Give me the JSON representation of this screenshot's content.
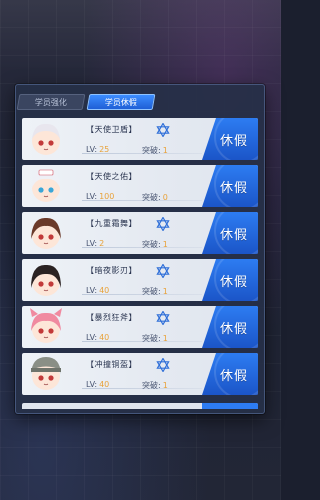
{
  "tabs": [
    {
      "label": "学员强化",
      "active": false
    },
    {
      "label": "学员休假",
      "active": true
    }
  ],
  "stats_labels": {
    "lv": "LV:",
    "tupo": "突破:"
  },
  "rest_label": "休假",
  "students": [
    {
      "name": "【天使卫盾】",
      "lv": "25",
      "tupo": "1",
      "hair": "#e8e6ee",
      "eyes": "#c23a3a"
    },
    {
      "name": "【天使之佑】",
      "lv": "100",
      "tupo": "0",
      "hair": "#eef0f6",
      "eyes": "#3aa6d8"
    },
    {
      "name": "【九重霜舞】",
      "lv": "2",
      "tupo": "1",
      "hair": "#6a3a2a",
      "eyes": "#c23a3a"
    },
    {
      "name": "【暗夜影刃】",
      "lv": "40",
      "tupo": "1",
      "hair": "#2a2222",
      "eyes": "#c23a3a"
    },
    {
      "name": "【暴烈狂斧】",
      "lv": "40",
      "tupo": "1",
      "hair": "#f08aa0",
      "eyes": "#c23a3a"
    },
    {
      "name": "【冲撞铜盔】",
      "lv": "40",
      "tupo": "1",
      "hair": "#8a8f86",
      "eyes": "#c23a3a"
    }
  ],
  "colors": {
    "accent": "#2d7cf2",
    "value": "#e8a23a",
    "panel": "#263048"
  },
  "icons": {
    "star": "hexagram-star-icon"
  }
}
